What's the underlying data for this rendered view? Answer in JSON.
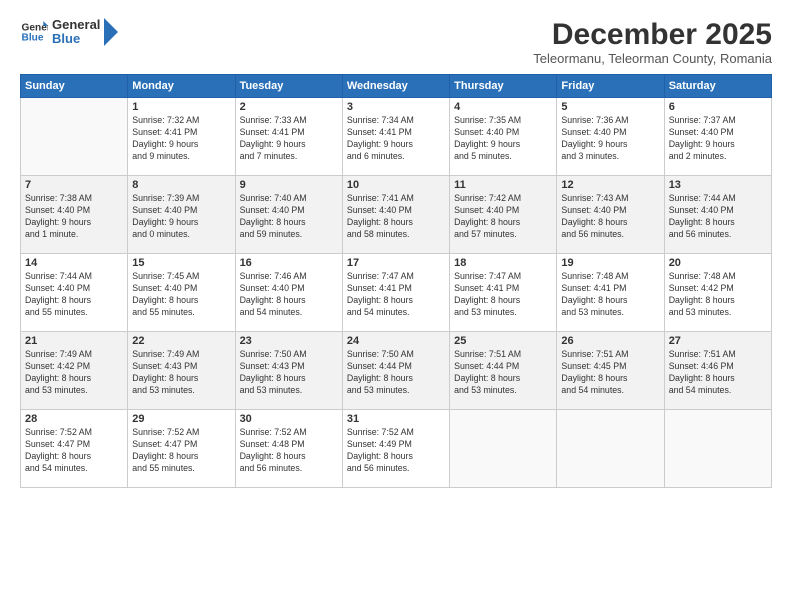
{
  "logo": {
    "general": "General",
    "blue": "Blue"
  },
  "title": "December 2025",
  "subtitle": "Teleormanu, Teleorman County, Romania",
  "days_header": [
    "Sunday",
    "Monday",
    "Tuesday",
    "Wednesday",
    "Thursday",
    "Friday",
    "Saturday"
  ],
  "weeks": [
    [
      {
        "day": "",
        "info": ""
      },
      {
        "day": "1",
        "info": "Sunrise: 7:32 AM\nSunset: 4:41 PM\nDaylight: 9 hours\nand 9 minutes."
      },
      {
        "day": "2",
        "info": "Sunrise: 7:33 AM\nSunset: 4:41 PM\nDaylight: 9 hours\nand 7 minutes."
      },
      {
        "day": "3",
        "info": "Sunrise: 7:34 AM\nSunset: 4:41 PM\nDaylight: 9 hours\nand 6 minutes."
      },
      {
        "day": "4",
        "info": "Sunrise: 7:35 AM\nSunset: 4:40 PM\nDaylight: 9 hours\nand 5 minutes."
      },
      {
        "day": "5",
        "info": "Sunrise: 7:36 AM\nSunset: 4:40 PM\nDaylight: 9 hours\nand 3 minutes."
      },
      {
        "day": "6",
        "info": "Sunrise: 7:37 AM\nSunset: 4:40 PM\nDaylight: 9 hours\nand 2 minutes."
      }
    ],
    [
      {
        "day": "7",
        "info": "Sunrise: 7:38 AM\nSunset: 4:40 PM\nDaylight: 9 hours\nand 1 minute."
      },
      {
        "day": "8",
        "info": "Sunrise: 7:39 AM\nSunset: 4:40 PM\nDaylight: 9 hours\nand 0 minutes."
      },
      {
        "day": "9",
        "info": "Sunrise: 7:40 AM\nSunset: 4:40 PM\nDaylight: 8 hours\nand 59 minutes."
      },
      {
        "day": "10",
        "info": "Sunrise: 7:41 AM\nSunset: 4:40 PM\nDaylight: 8 hours\nand 58 minutes."
      },
      {
        "day": "11",
        "info": "Sunrise: 7:42 AM\nSunset: 4:40 PM\nDaylight: 8 hours\nand 57 minutes."
      },
      {
        "day": "12",
        "info": "Sunrise: 7:43 AM\nSunset: 4:40 PM\nDaylight: 8 hours\nand 56 minutes."
      },
      {
        "day": "13",
        "info": "Sunrise: 7:44 AM\nSunset: 4:40 PM\nDaylight: 8 hours\nand 56 minutes."
      }
    ],
    [
      {
        "day": "14",
        "info": "Sunrise: 7:44 AM\nSunset: 4:40 PM\nDaylight: 8 hours\nand 55 minutes."
      },
      {
        "day": "15",
        "info": "Sunrise: 7:45 AM\nSunset: 4:40 PM\nDaylight: 8 hours\nand 55 minutes."
      },
      {
        "day": "16",
        "info": "Sunrise: 7:46 AM\nSunset: 4:40 PM\nDaylight: 8 hours\nand 54 minutes."
      },
      {
        "day": "17",
        "info": "Sunrise: 7:47 AM\nSunset: 4:41 PM\nDaylight: 8 hours\nand 54 minutes."
      },
      {
        "day": "18",
        "info": "Sunrise: 7:47 AM\nSunset: 4:41 PM\nDaylight: 8 hours\nand 53 minutes."
      },
      {
        "day": "19",
        "info": "Sunrise: 7:48 AM\nSunset: 4:41 PM\nDaylight: 8 hours\nand 53 minutes."
      },
      {
        "day": "20",
        "info": "Sunrise: 7:48 AM\nSunset: 4:42 PM\nDaylight: 8 hours\nand 53 minutes."
      }
    ],
    [
      {
        "day": "21",
        "info": "Sunrise: 7:49 AM\nSunset: 4:42 PM\nDaylight: 8 hours\nand 53 minutes."
      },
      {
        "day": "22",
        "info": "Sunrise: 7:49 AM\nSunset: 4:43 PM\nDaylight: 8 hours\nand 53 minutes."
      },
      {
        "day": "23",
        "info": "Sunrise: 7:50 AM\nSunset: 4:43 PM\nDaylight: 8 hours\nand 53 minutes."
      },
      {
        "day": "24",
        "info": "Sunrise: 7:50 AM\nSunset: 4:44 PM\nDaylight: 8 hours\nand 53 minutes."
      },
      {
        "day": "25",
        "info": "Sunrise: 7:51 AM\nSunset: 4:44 PM\nDaylight: 8 hours\nand 53 minutes."
      },
      {
        "day": "26",
        "info": "Sunrise: 7:51 AM\nSunset: 4:45 PM\nDaylight: 8 hours\nand 54 minutes."
      },
      {
        "day": "27",
        "info": "Sunrise: 7:51 AM\nSunset: 4:46 PM\nDaylight: 8 hours\nand 54 minutes."
      }
    ],
    [
      {
        "day": "28",
        "info": "Sunrise: 7:52 AM\nSunset: 4:47 PM\nDaylight: 8 hours\nand 54 minutes."
      },
      {
        "day": "29",
        "info": "Sunrise: 7:52 AM\nSunset: 4:47 PM\nDaylight: 8 hours\nand 55 minutes."
      },
      {
        "day": "30",
        "info": "Sunrise: 7:52 AM\nSunset: 4:48 PM\nDaylight: 8 hours\nand 56 minutes."
      },
      {
        "day": "31",
        "info": "Sunrise: 7:52 AM\nSunset: 4:49 PM\nDaylight: 8 hours\nand 56 minutes."
      },
      {
        "day": "",
        "info": ""
      },
      {
        "day": "",
        "info": ""
      },
      {
        "day": "",
        "info": ""
      }
    ]
  ]
}
